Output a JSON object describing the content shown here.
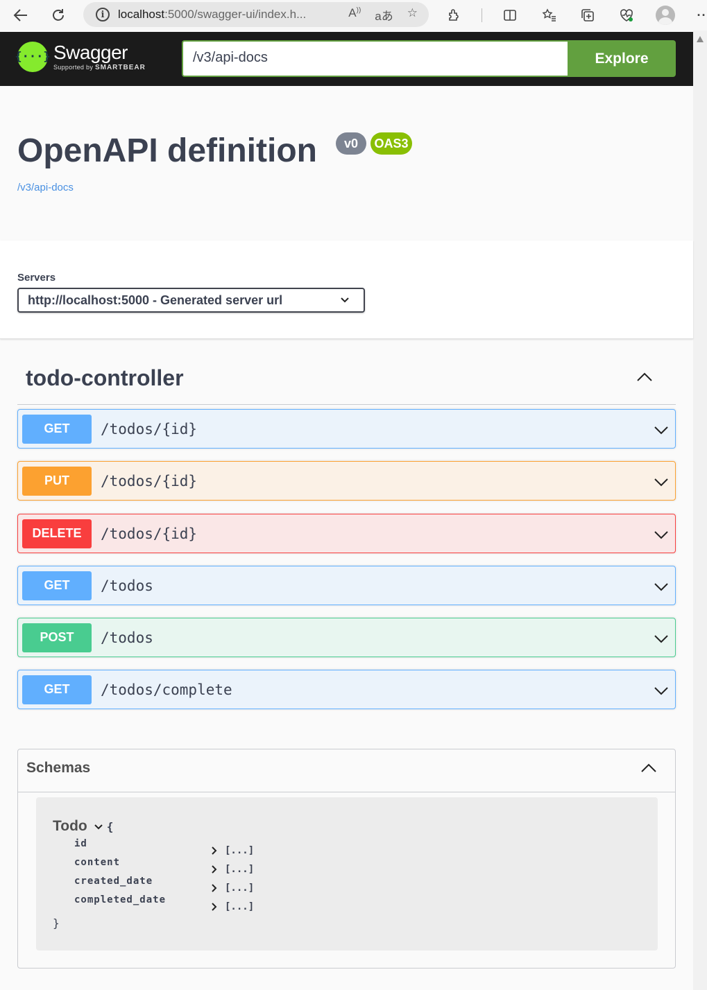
{
  "browser": {
    "url_host": "localhost",
    "url_path": ":5000/swagger-ui/index.h...",
    "read_aloud_glyph": "A",
    "translate_glyph": "aあ"
  },
  "header": {
    "logo_name": "Swagger",
    "logo_sub_prefix": "Supported by",
    "logo_sub_brand": "SMARTBEAR",
    "url_value": "/v3/api-docs",
    "explore_label": "Explore"
  },
  "info": {
    "title": "OpenAPI definition",
    "version": "v0",
    "oas": "OAS3",
    "spec_link": "/v3/api-docs"
  },
  "servers": {
    "label": "Servers",
    "selected": "http://localhost:5000 - Generated server url"
  },
  "tag": {
    "name": "todo-controller"
  },
  "operations": [
    {
      "method": "GET",
      "path": "/todos/{id}"
    },
    {
      "method": "PUT",
      "path": "/todos/{id}"
    },
    {
      "method": "DELETE",
      "path": "/todos/{id}"
    },
    {
      "method": "GET",
      "path": "/todos"
    },
    {
      "method": "POST",
      "path": "/todos"
    },
    {
      "method": "GET",
      "path": "/todos/complete"
    }
  ],
  "schemas": {
    "title": "Schemas",
    "model": {
      "name": "Todo",
      "open_brace": "{",
      "close_brace": "}",
      "properties": [
        {
          "name": "id",
          "value": "[...]"
        },
        {
          "name": "content",
          "value": "[...]"
        },
        {
          "name": "created_date",
          "value": "[...]"
        },
        {
          "name": "completed_date",
          "value": "[...]"
        }
      ]
    }
  },
  "colors": {
    "get": "#61affe",
    "put": "#fca130",
    "delete": "#f93e3e",
    "post": "#49cc90",
    "swagger_green": "#62a03f",
    "header_bg": "#1b1b1b"
  }
}
